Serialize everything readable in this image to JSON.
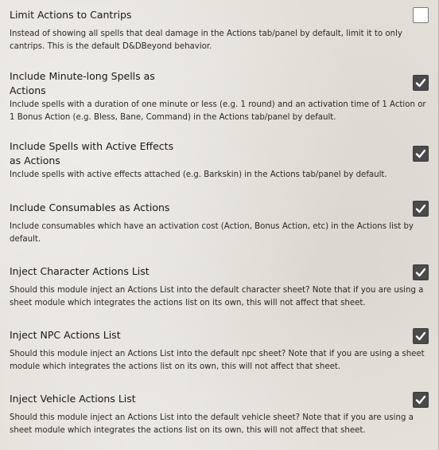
{
  "settings": [
    {
      "name": "Limit Actions to Cantrips",
      "description": "Instead of showing all spells that deal damage in the Actions tab/panel by default, limit it to only cantrips. This is the default D&DBeyond behavior.",
      "checked": false
    },
    {
      "name": "Include Minute-long Spells as\nActions",
      "description": "Include spells with a duration of one minute or less (e.g. 1 round) and an activation time of 1 Action or 1 Bonus Action (e.g. Bless, Bane, Command) in the Actions tab/panel by default.",
      "checked": true
    },
    {
      "name": "Include Spells with Active Effects\nas Actions",
      "description": "Include spells with active effects attached (e.g. Barkskin) in the Actions tab/panel by default.",
      "checked": true
    },
    {
      "name": "Include Consumables as Actions",
      "description": "Include consumables which have an activation cost (Action, Bonus Action, etc) in the Actions list by default.",
      "checked": true
    },
    {
      "name": "Inject Character Actions List",
      "description": "Should this module inject an Actions List into the default character sheet? Note that if you are using a sheet module which integrates the actions list on its own, this will not affect that sheet.",
      "checked": true
    },
    {
      "name": "Inject NPC Actions List",
      "description": "Should this module inject an Actions List into the default npc sheet? Note that if you are using a sheet module which integrates the actions list on its own, this will not affect that sheet.",
      "checked": true
    },
    {
      "name": "Inject Vehicle Actions List",
      "description": "Should this module inject an Actions List into the default vehicle sheet? Note that if you are using a sheet module which integrates the actions list on its own, this will not affect that sheet.",
      "checked": true
    }
  ],
  "icons": {
    "checkmark": "checkmark-icon"
  },
  "colors": {
    "checkbox_checked_bg": "#4a4a4a",
    "checkbox_unchecked_bg": "#ffffff",
    "checkmark": "#ffffff"
  }
}
